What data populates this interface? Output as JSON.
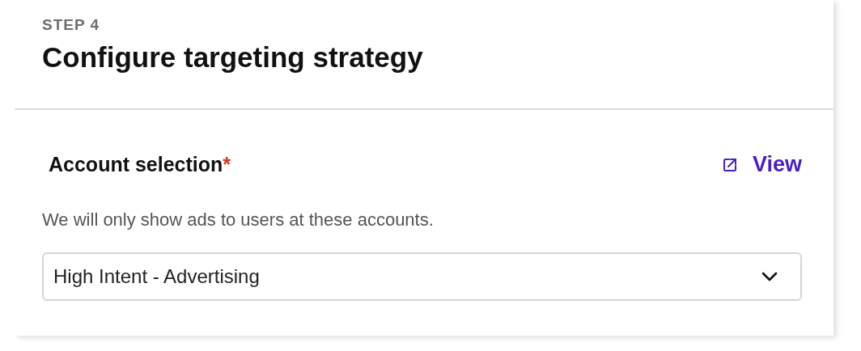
{
  "header": {
    "step": "STEP 4",
    "title": "Configure targeting strategy"
  },
  "field": {
    "label": "Account selection",
    "required_mark": "*",
    "link": "View",
    "description": "We will only show ads to users at these accounts.",
    "value": "High Intent - Advertising"
  }
}
